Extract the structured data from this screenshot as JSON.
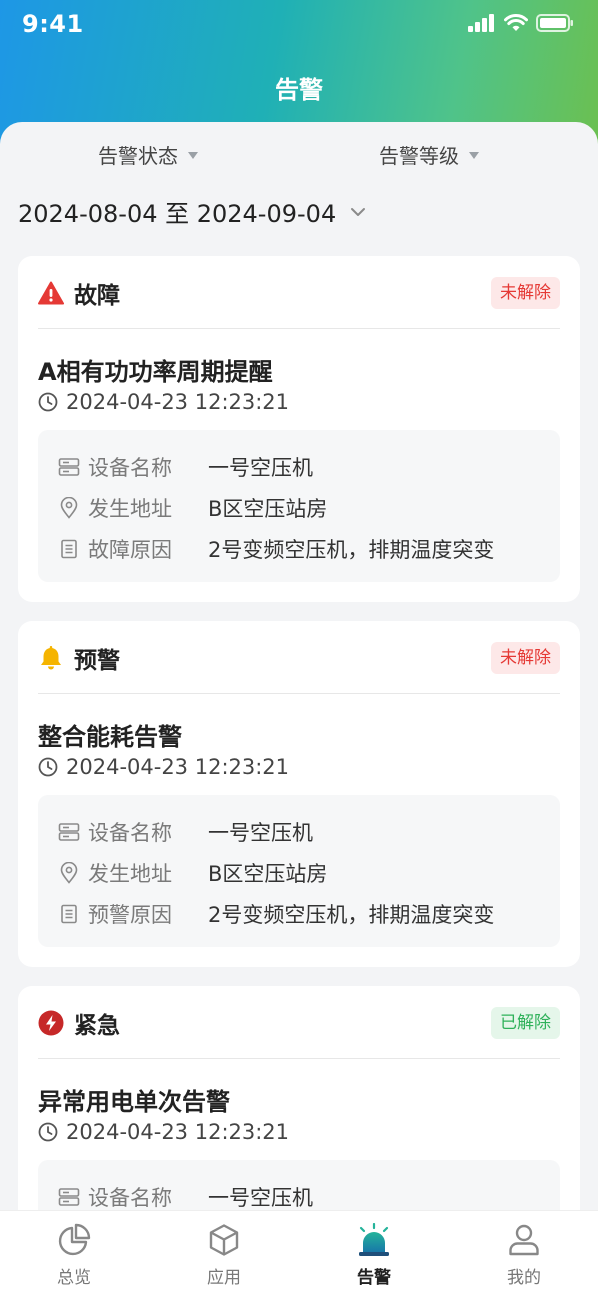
{
  "status_bar": {
    "time": "9:41"
  },
  "nav": {
    "title": "告警"
  },
  "filters": {
    "status_label": "告警状态",
    "level_label": "告警等级",
    "date_range": "2024-08-04 至 2024-09-04"
  },
  "alerts": [
    {
      "type": "故障",
      "status": "未解除",
      "title": "A相有功功率周期提醒",
      "time": "2024-04-23 12:23:21",
      "device_label": "设备名称",
      "device": "一号空压机",
      "location_label": "发生地址",
      "location": "B区空压站房",
      "reason_label": "故障原因",
      "reason": "2号变频空压机，排期温度突变"
    },
    {
      "type": "预警",
      "status": "未解除",
      "title": "整合能耗告警",
      "time": "2024-04-23 12:23:21",
      "device_label": "设备名称",
      "device": "一号空压机",
      "location_label": "发生地址",
      "location": "B区空压站房",
      "reason_label": "预警原因",
      "reason": "2号变频空压机，排期温度突变"
    },
    {
      "type": "紧急",
      "status": "已解除",
      "title": "异常用电单次告警",
      "time": "2024-04-23 12:23:21",
      "device_label": "设备名称",
      "device": "一号空压机"
    }
  ],
  "tabbar": {
    "items": [
      {
        "label": "总览",
        "icon": "pie-chart-icon"
      },
      {
        "label": "应用",
        "icon": "cube-icon"
      },
      {
        "label": "告警",
        "icon": "alarm-light-icon"
      },
      {
        "label": "我的",
        "icon": "user-icon"
      }
    ],
    "active": "告警"
  },
  "colors": {
    "header_gradient_start": "#1e97e6",
    "header_gradient_end": "#6cc04f",
    "unresolved": "#e53935",
    "resolved": "#2fb15a",
    "fault_icon": "#e53935",
    "warning_icon": "#f5b400",
    "urgent_icon": "#c62828",
    "active_tab": "#1a9e86"
  }
}
